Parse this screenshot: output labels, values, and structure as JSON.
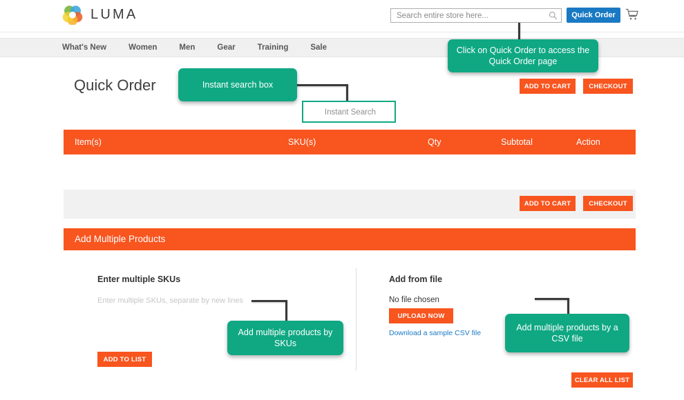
{
  "header": {
    "logo_text": "LUMA",
    "logo_icon": "luma-flower-logo",
    "search_placeholder": "Search entire store here...",
    "search_value": "",
    "search_icon": "search-icon",
    "quick_order_label": "Quick Order",
    "cart_icon": "shopping-cart-icon"
  },
  "nav": {
    "items": [
      {
        "label": "What's New"
      },
      {
        "label": "Women"
      },
      {
        "label": "Men"
      },
      {
        "label": "Gear"
      },
      {
        "label": "Training"
      },
      {
        "label": "Sale"
      }
    ]
  },
  "main": {
    "page_title": "Quick Order",
    "top_actions": {
      "add_to_cart": "ADD TO CART",
      "checkout": "CHECKOUT"
    },
    "instant_search": {
      "placeholder": "Instant Search",
      "value": ""
    },
    "table": {
      "headers": [
        "Item(s)",
        "SKU(s)",
        "Qty",
        "Subtotal",
        "Action"
      ],
      "rows": []
    },
    "bottom_actions": {
      "add_to_cart": "ADD TO CART",
      "checkout": "CHECKOUT"
    },
    "add_multiple": {
      "section_title": "Add Multiple Products",
      "skus_column": {
        "heading": "Enter multiple SKUs",
        "textarea_placeholder": "Enter multiple SKUs, separate by new lines",
        "textarea_value": "",
        "add_to_list_label": "ADD TO LIST"
      },
      "file_column": {
        "heading": "Add from file",
        "file_status": "No file chosen",
        "upload_label": "UPLOAD NOW",
        "sample_link": "Download a sample CSV file"
      },
      "clear_all_label": "CLEAR ALL LIST"
    }
  },
  "annotations": [
    {
      "id": "quick-order",
      "text": "Click on Quick Order to access the Quick Order page"
    },
    {
      "id": "instant-search",
      "text": "Instant search box"
    },
    {
      "id": "multiple-skus",
      "text": "Add multiple products by SKUs"
    },
    {
      "id": "csv-file",
      "text": "Add multiple products by a CSV file"
    }
  ],
  "colors": {
    "brand_orange": "#f8551f",
    "brand_blue": "#1979c3",
    "annotation_teal": "#0fa883",
    "nav_background": "#f0f0f0",
    "grey_bar": "#f1f1f1",
    "connector": "#3a3a3a"
  }
}
